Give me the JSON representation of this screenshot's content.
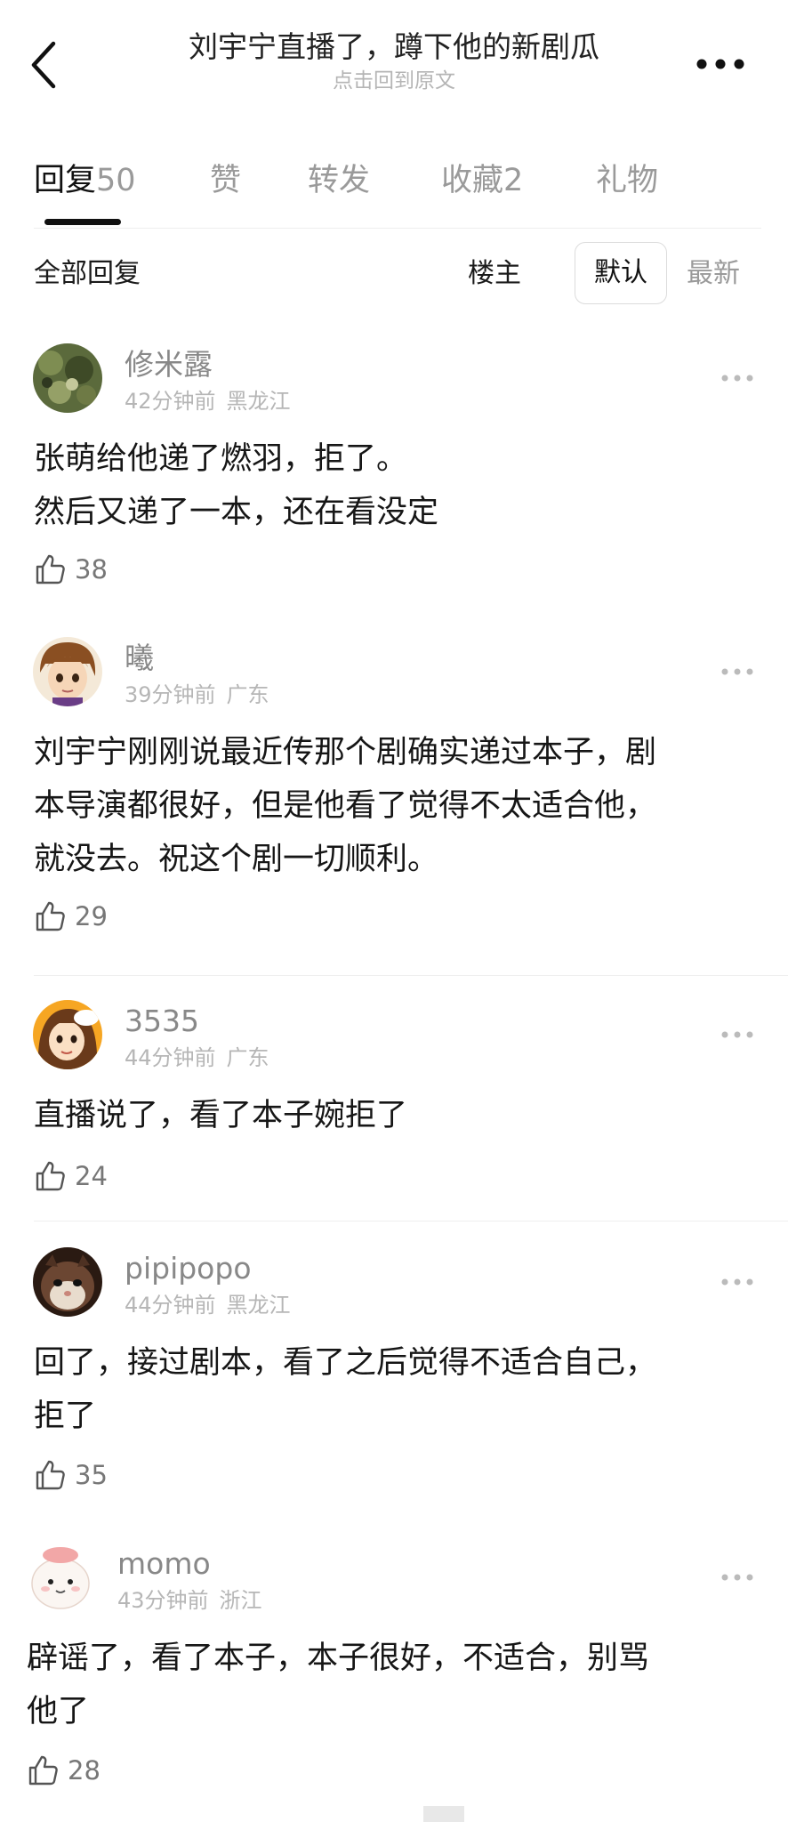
{
  "header": {
    "title": "刘宇宁直播了，蹲下他的新剧瓜",
    "subtitle": "点击回到原文",
    "back_icon": "chevron-left-icon",
    "more_icon": "more-horizontal-icon"
  },
  "tabs": [
    {
      "label": "回复",
      "count": "50"
    },
    {
      "label": "赞",
      "count": ""
    },
    {
      "label": "转发",
      "count": ""
    },
    {
      "label": "收藏",
      "count": "2"
    },
    {
      "label": "礼物",
      "count": ""
    }
  ],
  "filter": {
    "all": "全部回复",
    "owner": "楼主",
    "default": "默认",
    "latest": "最新"
  },
  "comments": [
    {
      "username": "修米露",
      "time": "42分钟前",
      "location": "黑龙江",
      "lines": [
        "张萌给他递了燃羽，拒了。",
        "然后又递了一本，还在看没定"
      ],
      "likes": "38"
    },
    {
      "username": "曦",
      "time": "39分钟前",
      "location": "广东",
      "lines": [
        "刘宇宁刚刚说最近传那个剧确实递过本子，剧",
        "本导演都很好，但是他看了觉得不太适合他，",
        "就没去。祝这个剧一切顺利。"
      ],
      "likes": "29"
    },
    {
      "username": "3535",
      "time": "44分钟前",
      "location": "广东",
      "lines": [
        "直播说了，看了本子婉拒了"
      ],
      "likes": "24"
    },
    {
      "username": "pipipopo",
      "time": "44分钟前",
      "location": "黑龙江",
      "lines": [
        "回了，接过剧本，看了之后觉得不适合自己，",
        "拒了"
      ],
      "likes": "35"
    },
    {
      "username": "momo",
      "time": "43分钟前",
      "location": "浙江",
      "lines": [
        "辟谣了，看了本子，本子很好，不适合，别骂",
        "他了"
      ],
      "likes": "28"
    }
  ],
  "colors": {
    "text_primary": "#111111",
    "text_secondary": "#9a9a9a",
    "meta": "#b6b6b6",
    "divider": "#efefef"
  }
}
